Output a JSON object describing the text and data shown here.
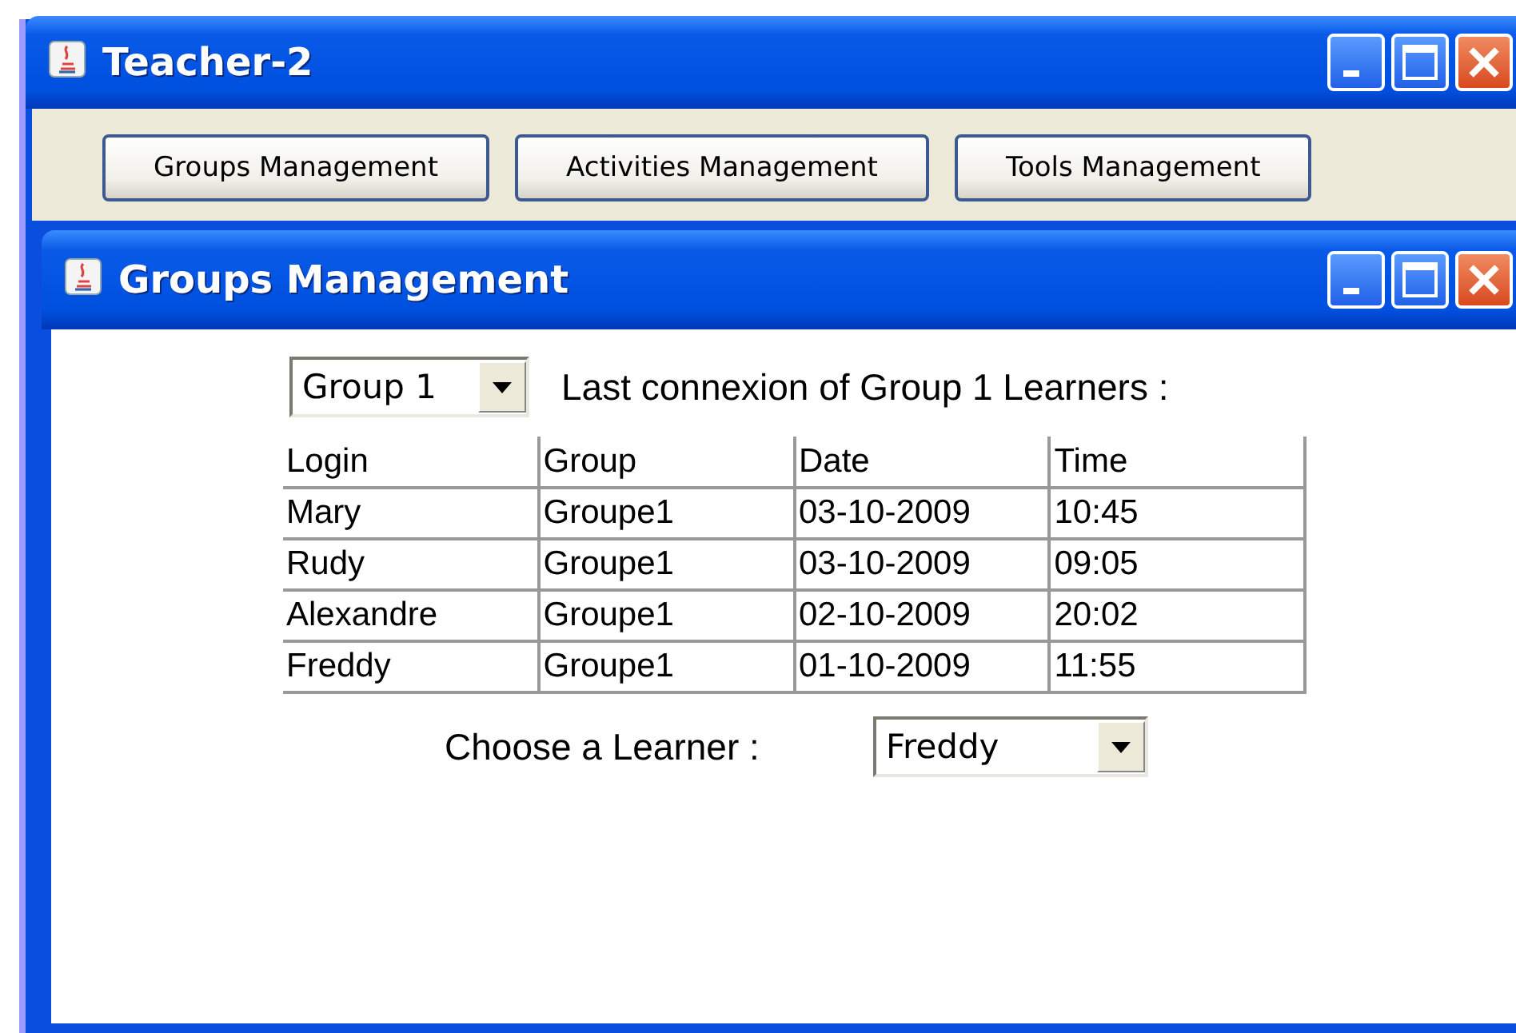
{
  "window": {
    "title": "Teacher-2"
  },
  "toolbar": {
    "buttons": [
      "Groups Management",
      "Activities Management",
      "Tools Management"
    ]
  },
  "inner_window": {
    "title": "Groups Management",
    "group_combo": {
      "value": "Group 1"
    },
    "caption": "Last connexion of Group 1 Learners :",
    "table": {
      "columns": [
        "Login",
        "Group",
        "Date",
        "Time"
      ],
      "rows": [
        [
          "Mary",
          "Groupe1",
          "03-10-2009",
          "10:45"
        ],
        [
          "Rudy",
          "Groupe1",
          "03-10-2009",
          "09:05"
        ],
        [
          "Alexandre",
          "Groupe1",
          "02-10-2009",
          "20:02"
        ],
        [
          "Freddy",
          "Groupe1",
          "01-10-2009",
          "11:55"
        ]
      ]
    },
    "learner_label": "Choose a Learner :",
    "learner_combo": {
      "value": "Freddy"
    }
  }
}
